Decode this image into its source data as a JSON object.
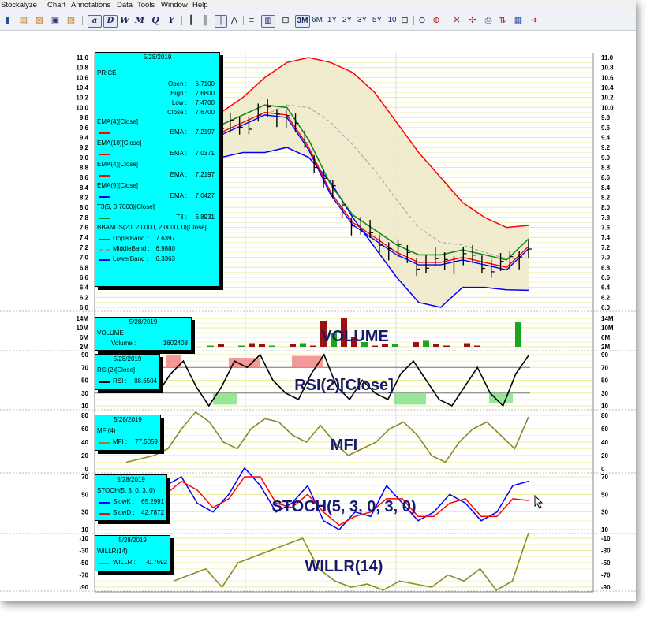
{
  "menu": [
    "Stockalyze",
    "Chart",
    "Annotations",
    "Data",
    "Tools",
    "Window",
    "Help"
  ],
  "toolbar": {
    "style_buttons": [
      "a",
      "D",
      "W",
      "M",
      "Q",
      "Y"
    ],
    "periods": [
      "3M",
      "6M",
      "1Y",
      "2Y",
      "3Y",
      "5Y",
      "10"
    ]
  },
  "axes": {
    "price_ticks": [
      "11.0",
      "10.8",
      "10.6",
      "10.4",
      "10.2",
      "10.0",
      "9.8",
      "9.6",
      "9.4",
      "9.2",
      "9.0",
      "8.8",
      "8.6",
      "8.4",
      "8.2",
      "8.0",
      "7.8",
      "7.6",
      "7.4",
      "7.2",
      "7.0",
      "6.8",
      "6.6",
      "6.4",
      "6.2",
      "6.0"
    ],
    "volume_ticks": [
      "14M",
      "10M",
      "6M",
      "2M"
    ],
    "rsi_ticks": [
      "90",
      "70",
      "50",
      "30",
      "10"
    ],
    "mfi_ticks": [
      "80",
      "60",
      "40",
      "20",
      "0"
    ],
    "stoch_ticks": [
      "70",
      "50",
      "30",
      "10"
    ],
    "willr_ticks": [
      "-10",
      "-30",
      "-50",
      "-70",
      "-90"
    ]
  },
  "panel_titles": {
    "volume": "VOLUME",
    "rsi": "RSI(2)[Close]",
    "mfi": "MFI",
    "stoch": "STOCH(5, 3, 0, 3, 0)",
    "willr": "WILLR(14)"
  },
  "legends": {
    "price": {
      "date": "5/28/2019",
      "title": "PRICE",
      "rows": [
        {
          "label": "Open :",
          "value": "6.7100"
        },
        {
          "label": "High :",
          "value": "7.6800"
        },
        {
          "label": "Low :",
          "value": "7.4700"
        },
        {
          "label": "Close :",
          "value": "7.6700"
        }
      ],
      "indicators": [
        {
          "name": "EMA(4)[Close]",
          "label": "EMA :",
          "value": "7.2197",
          "color": "#ff0000"
        },
        {
          "name": "EMA(10)[Close]",
          "label": "EMA :",
          "value": "7.0371",
          "color": "#ff0000"
        },
        {
          "name": "EMA(4)[Close]",
          "label": "EMA :",
          "value": "7.2197",
          "color": "#ff0000"
        },
        {
          "name": "EMA(9)[Close]",
          "label": "EMA :",
          "value": "7.0427",
          "color": "#0000ff"
        },
        {
          "name": "T3(5, 0.7000)[Close]",
          "label": "T3 :",
          "value": "6.8931",
          "color": "#1a8a1a"
        }
      ],
      "bbands": {
        "name": "BBANDS(20, 2.0000, 2.0000, 0)[Close]",
        "rows": [
          {
            "label": "UpperBand :",
            "value": "7.6397",
            "color": "#ff0000"
          },
          {
            "label": "MiddleBand :",
            "value": "6.9880",
            "color": "#999999"
          },
          {
            "label": "LowerBand :",
            "value": "6.3363",
            "color": "#0000ff"
          }
        ]
      }
    },
    "volume": {
      "date": "5/28/2019",
      "title": "VOLUME",
      "label": "Volume :",
      "value": "1602408"
    },
    "rsi": {
      "date": "5/28/2019",
      "title": "RSI(2)[Close]",
      "label": "RSI :",
      "value": "88.6504"
    },
    "mfi": {
      "date": "5/28/2019",
      "title": "MFI(4)",
      "label": "MFI :",
      "value": "77.5059"
    },
    "stoch": {
      "date": "5/28/2019",
      "title": "STOCH(5, 3, 0, 3, 0)",
      "rows": [
        {
          "label": "SlowK :",
          "value": "65.2991",
          "color": "#0000ff"
        },
        {
          "label": "SlowD :",
          "value": "42.7872",
          "color": "#ff0000"
        }
      ]
    },
    "willr": {
      "date": "5/28/2019",
      "title": "WILLR(14)",
      "label": "WILLR :",
      "value": "-0.7692"
    }
  },
  "colors": {
    "upper": "#ff0000",
    "lower": "#0000ff",
    "ema": "#ff0000",
    "ema_slow": "#0000ff",
    "t3": "#1a8a1a",
    "osc": "#8b8b2a",
    "legend_bg": "#00ffff"
  },
  "chart_data": {
    "type": "line",
    "series": [
      {
        "name": "UpperBand",
        "values": [
          9.9,
          10.2,
          10.6,
          10.9,
          11.0,
          10.9,
          10.7,
          10.3,
          9.7,
          9.1,
          8.6,
          8.1,
          7.8,
          7.6,
          7.64
        ]
      },
      {
        "name": "LowerBand",
        "values": [
          9.0,
          9.1,
          9.1,
          9.2,
          9.0,
          8.5,
          7.8,
          7.2,
          6.6,
          6.1,
          6.0,
          6.4,
          6.4,
          6.35,
          6.34
        ]
      },
      {
        "name": "EMA",
        "values": [
          9.5,
          9.7,
          9.9,
          9.85,
          9.2,
          8.3,
          7.7,
          7.4,
          7.1,
          6.9,
          6.9,
          7.0,
          6.9,
          6.8,
          7.22
        ]
      }
    ],
    "volume": [
      2,
      2.5,
      3,
      2,
      2.5,
      3.5,
      3,
      2.5,
      2,
      3,
      3.5,
      2.5,
      13,
      8,
      14,
      6,
      4,
      2.5,
      3,
      3,
      2,
      4,
      4.5,
      3,
      2.5,
      2,
      3.5,
      2.5,
      2,
      1.5,
      2,
      12.5
    ],
    "rsi": [
      30,
      60,
      80,
      40,
      10,
      40,
      80,
      70,
      90,
      50,
      30,
      20,
      60,
      90,
      40,
      20,
      50,
      30,
      20,
      60,
      80,
      50,
      20,
      10,
      40,
      70,
      30,
      10,
      60,
      88.65
    ],
    "mfi": [
      10,
      15,
      20,
      30,
      60,
      85,
      70,
      40,
      30,
      60,
      75,
      70,
      50,
      40,
      65,
      40,
      20,
      30,
      40,
      60,
      70,
      50,
      20,
      10,
      40,
      60,
      70,
      50,
      30,
      77.5
    ],
    "stoch_k": [
      60,
      70,
      40,
      30,
      50,
      80,
      60,
      30,
      40,
      60,
      20,
      10,
      30,
      25,
      60,
      40,
      20,
      30,
      50,
      40,
      20,
      30,
      60,
      65
    ],
    "stoch_d": [
      50,
      65,
      55,
      35,
      45,
      70,
      70,
      40,
      35,
      50,
      30,
      15,
      25,
      30,
      45,
      45,
      25,
      25,
      40,
      45,
      25,
      25,
      45,
      43
    ],
    "willr": [
      -80,
      -70,
      -60,
      -90,
      -50,
      -40,
      -30,
      -20,
      -10,
      -60,
      -80,
      -90,
      -85,
      -95,
      -80,
      -85,
      -90,
      -70,
      -80,
      -60,
      -95,
      -80,
      -1
    ]
  }
}
